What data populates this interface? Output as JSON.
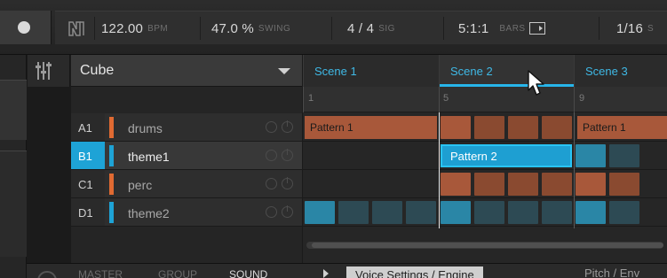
{
  "transport": {
    "tempo_value": "122.00",
    "tempo_unit": "BPM",
    "swing_value": "47.0 %",
    "swing_unit": "SWING",
    "signature_value": "4 / 4",
    "signature_unit": "SIG",
    "position_value": "5:1:1",
    "bars_label": "BARS",
    "grid_value": "1/16",
    "grid_unit": "S"
  },
  "group": {
    "name": "Cube"
  },
  "sounds": [
    {
      "slot": "A1",
      "label": "drums",
      "color": "#e06a32",
      "selected": false
    },
    {
      "slot": "B1",
      "label": "theme1",
      "color": "#1ea3d6",
      "selected": true
    },
    {
      "slot": "C1",
      "label": "perc",
      "color": "#e06a32",
      "selected": false
    },
    {
      "slot": "D1",
      "label": "theme2",
      "color": "#1ea3d6",
      "selected": false
    }
  ],
  "scenes": [
    {
      "label": "Scene 1",
      "active": false
    },
    {
      "label": "Scene 2",
      "active": true
    },
    {
      "label": "Scene 3",
      "active": false
    }
  ],
  "timeline": {
    "ticks": [
      "1",
      "5",
      "9"
    ]
  },
  "patterns": [
    {
      "track": "drums",
      "label": "Pattern 1",
      "scene": "Scene 1"
    },
    {
      "track": "theme1",
      "label": "Pattern 2",
      "scene": "Scene 2",
      "selected": true
    },
    {
      "track": "drums",
      "label": "Pattern 1",
      "scene": "Scene 3"
    }
  ],
  "bottom": {
    "tabs": [
      "MASTER",
      "GROUP",
      "SOUND"
    ],
    "active_tab": "SOUND",
    "page_label": "Voice Settings / Engine",
    "next_page": "Pitch / Env"
  },
  "colors": {
    "accent_blue": "#1ea3d6",
    "accent_orange": "#e06a32",
    "cell_orange": "#8a4a30",
    "cell_blue": "#2d4a54"
  },
  "icons": [
    "maschine-logo-icon",
    "mixer-icon",
    "dropdown-caret-icon",
    "bars-follow-icon",
    "mute-solo-icon",
    "power-icon",
    "mouse-pointer-icon"
  ]
}
